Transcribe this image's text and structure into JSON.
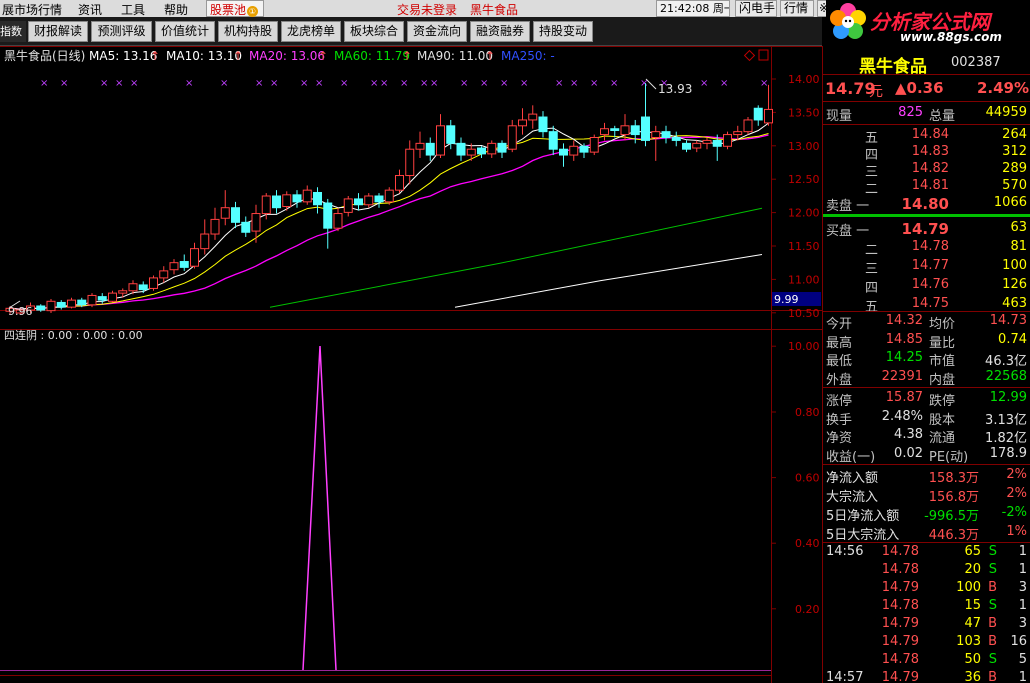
{
  "menubar": {
    "items": [
      "展市场行情",
      "资讯",
      "工具",
      "帮助"
    ],
    "pool_label": "股票池",
    "pool_badge": "①",
    "status_login": "交易未登录",
    "status_stock": "黑牛食品",
    "clock": "21:42:08 周一",
    "btn_flash": "闪电手",
    "btn_quote": "行情",
    "btn_more": "※"
  },
  "logo": {
    "title": "分析家公式网",
    "url": "www.88gs.com"
  },
  "toolbar": {
    "first": "指数",
    "buttons": [
      "财报解读",
      "预测评级",
      "价值统计",
      "机构持股",
      "龙虎榜单",
      "板块综合",
      "资金流向",
      "融资融券",
      "持股变动"
    ]
  },
  "chart": {
    "header_name": "黑牛食品(日线)",
    "ma5": "MA5: 13.16",
    "ma10": "MA10: 13.10",
    "ma20": "MA20: 13.06",
    "ma60": "MA60: 11.79",
    "ma90": "MA90: 11.00",
    "ma250": "MA250: -",
    "arrow": "↑",
    "price_axis": [
      "14.00",
      "13.50",
      "13.00",
      "12.50",
      "12.00",
      "11.50",
      "11.00",
      "10.50",
      "10.00"
    ],
    "high_label": "13.93",
    "low_label": "9.96",
    "price_tag": "9.99",
    "indicator_name": "四连阴 : 0.00 : 0.00 : 0.00",
    "indicator_axis": [
      "0.80",
      "0.60",
      "0.40",
      "0.20"
    ],
    "colors": {
      "up": "#ff4040",
      "down": "#54ffff",
      "ma5": "#ffffff",
      "ma10": "#ffff00",
      "ma20": "#ff00ff",
      "ma60": "#00c000",
      "ma90": "#ffffff",
      "indicator": "#ff40ff"
    }
  },
  "panel": {
    "name": "黑牛食品",
    "code": "002387",
    "price": "14.79",
    "price_unit": "元",
    "change": "▲0.36",
    "change_pct": "2.49%",
    "now_vol_label": "现量",
    "now_vol": "825",
    "total_vol_label": "总量",
    "total_vol": "44959",
    "sell": [
      {
        "label": "五",
        "price": "14.84",
        "vol": "264"
      },
      {
        "label": "四",
        "price": "14.83",
        "vol": "312"
      },
      {
        "label": "三",
        "price": "14.82",
        "vol": "289"
      },
      {
        "label": "二",
        "price": "14.81",
        "vol": "570"
      },
      {
        "label": "卖盘 一",
        "price": "14.80",
        "vol": "1066"
      }
    ],
    "buy": [
      {
        "label": "买盘 一",
        "price": "14.79",
        "vol": "63"
      },
      {
        "label": "二",
        "price": "14.78",
        "vol": "81"
      },
      {
        "label": "三",
        "price": "14.77",
        "vol": "100"
      },
      {
        "label": "四",
        "price": "14.76",
        "vol": "126"
      },
      {
        "label": "五",
        "price": "14.75",
        "vol": "463"
      }
    ],
    "stats": [
      {
        "l1": "今开",
        "v1": "14.32",
        "c1": "red",
        "l2": "均价",
        "v2": "14.73",
        "c2": "red"
      },
      {
        "l1": "最高",
        "v1": "14.85",
        "c1": "red",
        "l2": "量比",
        "v2": "0.74",
        "c2": "yellow"
      },
      {
        "l1": "最低",
        "v1": "14.25",
        "c1": "green",
        "l2": "市值",
        "v2": "46.3亿",
        "c2": "white"
      },
      {
        "l1": "外盘",
        "v1": "22391",
        "c1": "red",
        "l2": "内盘",
        "v2": "22568",
        "c2": "green"
      }
    ],
    "stats2": [
      {
        "l1": "涨停",
        "v1": "15.87",
        "c1": "red",
        "l2": "跌停",
        "v2": "12.99",
        "c2": "green"
      },
      {
        "l1": "换手",
        "v1": "2.48%",
        "c1": "white",
        "l2": "股本",
        "v2": "3.13亿",
        "c2": "white"
      },
      {
        "l1": "净资",
        "v1": "4.38",
        "c1": "white",
        "l2": "流通",
        "v2": "1.82亿",
        "c2": "white"
      },
      {
        "l1": "收益(一)",
        "v1": "0.02",
        "c1": "white",
        "l2": "PE(动)",
        "v2": "178.9",
        "c2": "white"
      }
    ],
    "flows": [
      {
        "label": "净流入额",
        "value": "158.3万",
        "pct": "2%",
        "color": "red"
      },
      {
        "label": "大宗流入",
        "value": "156.8万",
        "pct": "2%",
        "color": "red"
      },
      {
        "label": "5日净流入额",
        "value": "-996.5万",
        "pct": "-2%",
        "color": "green"
      },
      {
        "label": "5日大宗流入",
        "value": "446.3万",
        "pct": "1%",
        "color": "red"
      }
    ],
    "ticks": [
      {
        "time": "14:56",
        "price": "14.78",
        "vol": "65",
        "bs": "S",
        "n": "1"
      },
      {
        "time": "",
        "price": "14.78",
        "vol": "20",
        "bs": "S",
        "n": "1"
      },
      {
        "time": "",
        "price": "14.79",
        "vol": "100",
        "bs": "B",
        "n": "3"
      },
      {
        "time": "",
        "price": "14.78",
        "vol": "15",
        "bs": "S",
        "n": "1"
      },
      {
        "time": "",
        "price": "14.79",
        "vol": "47",
        "bs": "B",
        "n": "3"
      },
      {
        "time": "",
        "price": "14.79",
        "vol": "103",
        "bs": "B",
        "n": "16"
      },
      {
        "time": "",
        "price": "14.78",
        "vol": "50",
        "bs": "S",
        "n": "5"
      },
      {
        "time": "14:57",
        "price": "14.79",
        "vol": "36",
        "bs": "B",
        "n": "1"
      }
    ]
  }
}
